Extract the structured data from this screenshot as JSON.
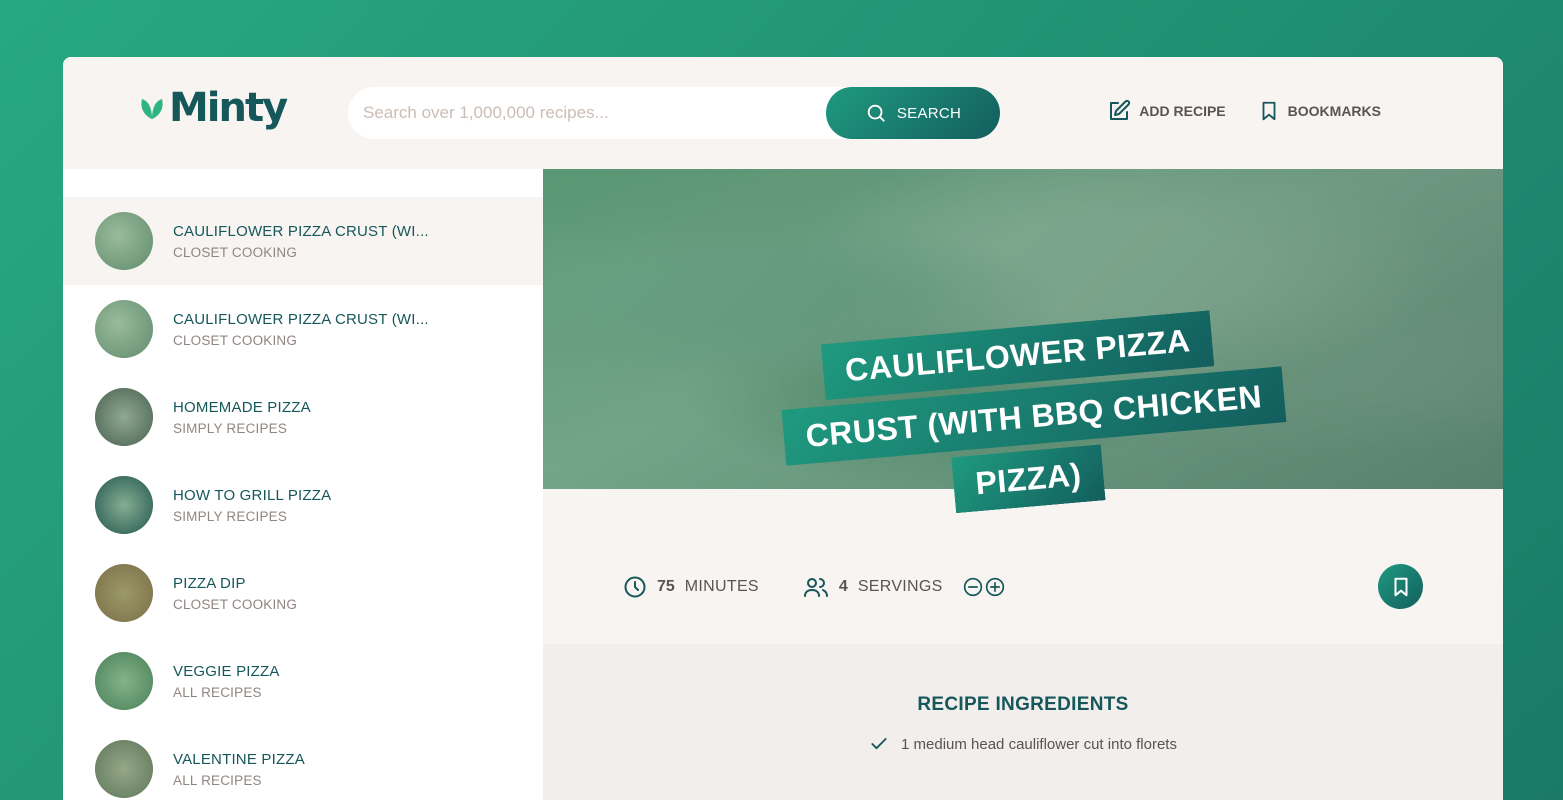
{
  "app": {
    "name": "Minty"
  },
  "search": {
    "placeholder": "Search over 1,000,000 recipes...",
    "button_label": "SEARCH"
  },
  "nav": {
    "add_recipe": "ADD RECIPE",
    "bookmarks": "BOOKMARKS"
  },
  "results": [
    {
      "title": "CAULIFLOWER PIZZA CRUST (WI...",
      "publisher": "CLOSET COOKING",
      "active": true
    },
    {
      "title": "CAULIFLOWER PIZZA CRUST (WI...",
      "publisher": "CLOSET COOKING",
      "active": false
    },
    {
      "title": "HOMEMADE PIZZA",
      "publisher": "SIMPLY RECIPES",
      "active": false
    },
    {
      "title": "HOW TO GRILL PIZZA",
      "publisher": "SIMPLY RECIPES",
      "active": false
    },
    {
      "title": "PIZZA DIP",
      "publisher": "CLOSET COOKING",
      "active": false
    },
    {
      "title": "VEGGIE PIZZA",
      "publisher": "ALL RECIPES",
      "active": false
    },
    {
      "title": "VALENTINE PIZZA",
      "publisher": "ALL RECIPES",
      "active": false
    }
  ],
  "recipe": {
    "title": "CAULIFLOWER PIZZA CRUST (WITH BBQ CHICKEN PIZZA)",
    "cooking_time": "75",
    "cooking_time_unit": "MINUTES",
    "servings": "4",
    "servings_unit": "SERVINGS"
  },
  "ingredients": {
    "heading": "RECIPE INGREDIENTS",
    "items": [
      "1 medium head cauliflower cut into florets"
    ]
  },
  "colors": {
    "brand_dark": "#15575a",
    "brand_green": "#1f9a7f",
    "background": "#f8f4f2"
  }
}
